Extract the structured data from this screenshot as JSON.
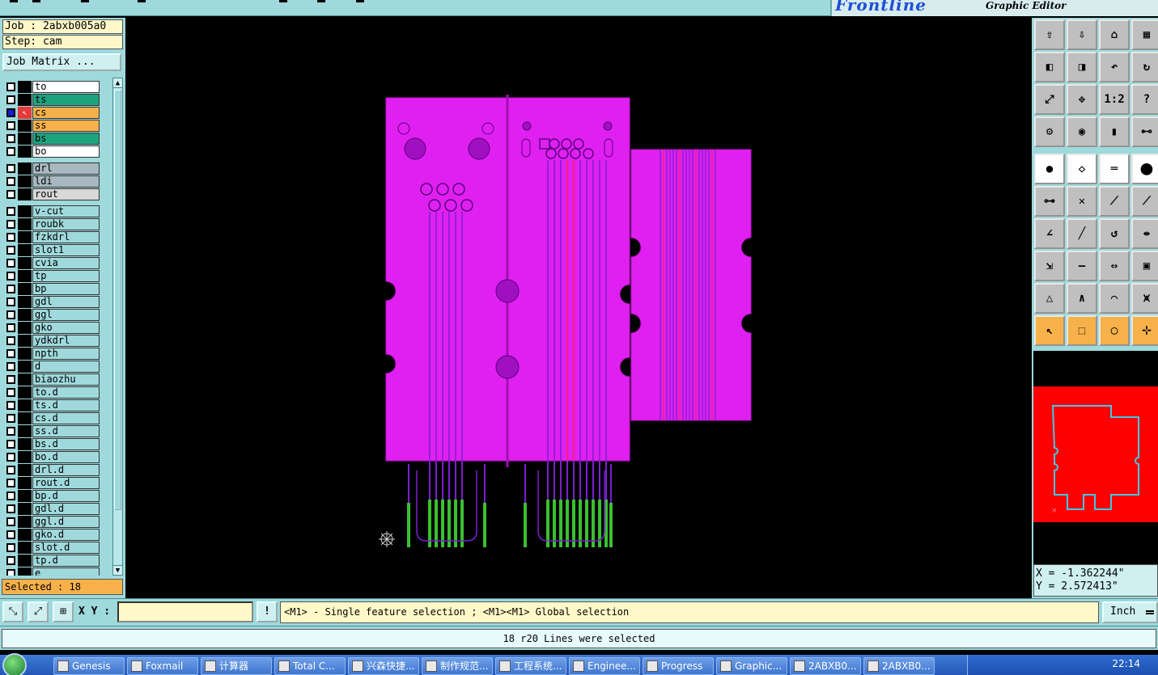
{
  "app": {
    "brand_logo": "Frontline",
    "brand_subtitle": "Graphic Editor"
  },
  "left_panel": {
    "job_label": "Job : 2abxb005a0",
    "step_label": "Step: cam",
    "job_matrix_button": "Job Matrix ...",
    "selected_label": "Selected : 18",
    "layers_board": [
      {
        "name": "to",
        "color": "#ffffff",
        "affected": false,
        "flag": ""
      },
      {
        "name": "ts",
        "color": "#1fa37e",
        "affected": false,
        "flag": ""
      },
      {
        "name": "cs",
        "color": "#f7b14a",
        "affected": true,
        "flag": "✎▣"
      },
      {
        "name": "ss",
        "color": "#f7b14a",
        "affected": false,
        "flag": "✎"
      },
      {
        "name": "bs",
        "color": "#1fa37e",
        "affected": false,
        "flag": ""
      },
      {
        "name": "bo",
        "color": "#ffffff",
        "affected": false,
        "flag": ""
      }
    ],
    "layers_drill": [
      {
        "name": "drl",
        "color": "#a8b8c0",
        "flag": ""
      },
      {
        "name": "ldi",
        "color": "#a8b8c0",
        "flag": ""
      },
      {
        "name": "rout",
        "color": "#d8d8d8",
        "flag": ""
      }
    ],
    "layers_misc": [
      {
        "name": "v-cut",
        "flag": ""
      },
      {
        "name": "roubk",
        "flag": ""
      },
      {
        "name": "fzkdrl",
        "flag": ""
      },
      {
        "name": "slot1",
        "flag": ""
      },
      {
        "name": "cvia",
        "flag": ""
      },
      {
        "name": "tp",
        "flag": ""
      },
      {
        "name": "bp",
        "flag": ""
      },
      {
        "name": "gdl",
        "flag": "✎"
      },
      {
        "name": "ggl",
        "flag": ""
      },
      {
        "name": "gko",
        "flag": ""
      },
      {
        "name": "ydkdrl",
        "flag": ""
      },
      {
        "name": "npth",
        "flag": ""
      },
      {
        "name": "d",
        "flag": ""
      },
      {
        "name": "biaozhu",
        "flag": ""
      },
      {
        "name": "to.d",
        "flag": ""
      },
      {
        "name": "ts.d",
        "flag": ""
      },
      {
        "name": "cs.d",
        "flag": "✎"
      },
      {
        "name": "ss.d",
        "flag": "✎"
      },
      {
        "name": "bs.d",
        "flag": ""
      },
      {
        "name": "bo.d",
        "flag": ""
      },
      {
        "name": "drl.d",
        "flag": ""
      },
      {
        "name": "rout.d",
        "flag": ""
      },
      {
        "name": "bp.d",
        "flag": ""
      },
      {
        "name": "gdl.d",
        "flag": "✎"
      },
      {
        "name": "ggl.d",
        "flag": ""
      },
      {
        "name": "gko.d",
        "flag": ""
      },
      {
        "name": "slot.d",
        "flag": ""
      },
      {
        "name": "tp.d",
        "flag": ""
      },
      {
        "name": "e",
        "flag": ""
      }
    ]
  },
  "right_panel": {
    "tool_buttons": [
      {
        "name": "clipboard-up-icon",
        "glyph": "⇧",
        "style": "normal"
      },
      {
        "name": "clipboard-down-icon",
        "glyph": "⇩",
        "style": "normal"
      },
      {
        "name": "home-icon",
        "glyph": "⌂",
        "style": "normal"
      },
      {
        "name": "window-split-icon",
        "glyph": "▦",
        "style": "normal"
      },
      {
        "name": "pan-left-icon",
        "glyph": "◧",
        "style": "normal"
      },
      {
        "name": "pan-right-icon",
        "glyph": "◨",
        "style": "normal"
      },
      {
        "name": "zoom-back-icon",
        "glyph": "↶",
        "style": "normal"
      },
      {
        "name": "redraw-icon",
        "glyph": "↻",
        "style": "normal"
      },
      {
        "name": "zoom-fit-icon",
        "glyph": "⤢",
        "style": "normal"
      },
      {
        "name": "zoom-center-icon",
        "glyph": "✥",
        "style": "normal"
      },
      {
        "name": "one-to-two-icon",
        "glyph": "1:2",
        "style": "normal"
      },
      {
        "name": "help-icon",
        "glyph": "?",
        "style": "normal"
      },
      {
        "name": "settings-icon",
        "glyph": "⚙",
        "style": "normal"
      },
      {
        "name": "snap-icon",
        "glyph": "◉",
        "style": "normal"
      },
      {
        "name": "traffic-light-icon",
        "glyph": "▮",
        "style": "normal"
      },
      {
        "name": "net-icon",
        "glyph": "⊷",
        "style": "normal"
      },
      {
        "name": "add-pad-icon",
        "glyph": "●",
        "style": "white"
      },
      {
        "name": "add-shape-icon",
        "glyph": "◇",
        "style": "white"
      },
      {
        "name": "measure-icon",
        "glyph": "═",
        "style": "white"
      },
      {
        "name": "dot-icon",
        "glyph": "⬤",
        "style": "white"
      },
      {
        "name": "connect-icon",
        "glyph": "⊶",
        "style": "normal"
      },
      {
        "name": "cross-icon",
        "glyph": "✕",
        "style": "normal"
      },
      {
        "name": "line-pad-icon",
        "glyph": "⟋",
        "style": "normal"
      },
      {
        "name": "line-end-icon",
        "glyph": "⟋",
        "style": "normal"
      },
      {
        "name": "angle-icon",
        "glyph": "∠",
        "style": "normal"
      },
      {
        "name": "slant-line-icon",
        "glyph": "╱",
        "style": "normal"
      },
      {
        "name": "arc-icon",
        "glyph": "↺",
        "style": "normal"
      },
      {
        "name": "mirror-icon",
        "glyph": "⇹",
        "style": "normal"
      },
      {
        "name": "pad-move-icon",
        "glyph": "⇲",
        "style": "normal"
      },
      {
        "name": "split-line-icon",
        "glyph": "—",
        "style": "normal"
      },
      {
        "name": "stretch-icon",
        "glyph": "⇔",
        "style": "normal"
      },
      {
        "name": "group-icon",
        "glyph": "▣",
        "style": "normal"
      },
      {
        "name": "triangle-icon",
        "glyph": "△",
        "style": "normal"
      },
      {
        "name": "peak-icon",
        "glyph": "∧",
        "style": "normal"
      },
      {
        "name": "arch-icon",
        "glyph": "⌒",
        "style": "normal"
      },
      {
        "name": "arch-line-icon",
        "glyph": "⩙",
        "style": "normal"
      },
      {
        "name": "select-arrow-icon",
        "glyph": "↖",
        "style": "orange"
      },
      {
        "name": "select-box-icon",
        "glyph": "⬚",
        "style": "orange"
      },
      {
        "name": "select-circle-icon",
        "glyph": "◯",
        "style": "orange"
      },
      {
        "name": "select-net-icon",
        "glyph": "⊹",
        "style": "orange"
      }
    ],
    "coord_x": "X = -1.362244\"",
    "coord_y": "Y = 2.572413\""
  },
  "command_bar": {
    "xy_label": "X Y :",
    "xy_value": "",
    "prompt_text": "<M1> - Single feature selection ; <M1><M1> Global selection",
    "units": "Inch"
  },
  "status_message": "18 r20 Lines were selected",
  "taskbar": {
    "tasks": [
      {
        "label": "Genesis"
      },
      {
        "label": "Foxmail"
      },
      {
        "label": "计算器"
      },
      {
        "label": "Total C..."
      },
      {
        "label": "兴森快捷..."
      },
      {
        "label": "制作规范..."
      },
      {
        "label": "工程系统..."
      },
      {
        "label": "Enginee..."
      },
      {
        "label": "Progress"
      },
      {
        "label": "Graphic..."
      },
      {
        "label": "2ABXB0..."
      },
      {
        "label": "2ABXB0..."
      }
    ],
    "clock": "22:14"
  },
  "colors": {
    "board": "#e020f0",
    "trace": "#7a1fd0",
    "trace_red": "#ff2060",
    "finger": "#3ac030",
    "preview_board": "#ff0000",
    "preview_outline": "#40c8e8"
  }
}
